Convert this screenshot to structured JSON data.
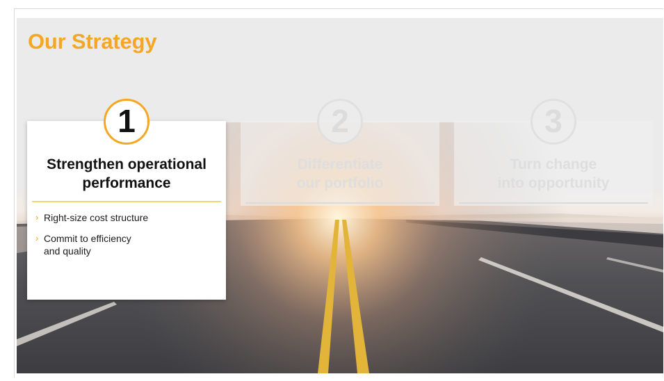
{
  "slide": {
    "title": "Our Strategy",
    "accent_color": "#f5a623"
  },
  "cards": [
    {
      "number": "1",
      "title_lines": [
        "Strengthen operational",
        "performance"
      ],
      "bullets": [
        "Right-size cost structure",
        "Commit to efficiency and quality"
      ],
      "state": "active"
    },
    {
      "number": "2",
      "title_lines": [
        "Differentiate",
        "our portfolio"
      ],
      "state": "inactive"
    },
    {
      "number": "3",
      "title_lines": [
        "Turn change",
        "into opportunity"
      ],
      "state": "inactive"
    }
  ],
  "icons": {
    "bullet": "chevron-right-icon"
  },
  "background_image": "highway-at-sunset"
}
